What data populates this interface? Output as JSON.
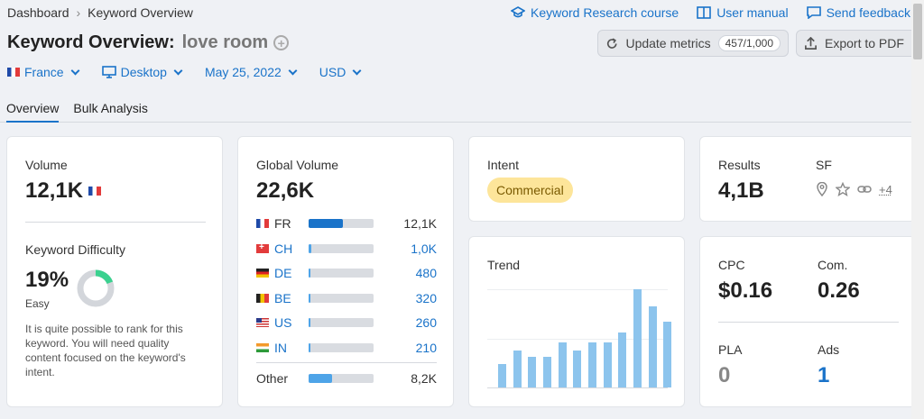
{
  "breadcrumb": {
    "root": "Dashboard",
    "current": "Keyword Overview"
  },
  "toplinks": {
    "course": "Keyword Research course",
    "manual": "User manual",
    "feedback": "Send feedback"
  },
  "title": {
    "label": "Keyword Overview:",
    "keyword": "love room"
  },
  "buttons": {
    "update": "Update metrics",
    "update_count": "457/1,000",
    "export": "Export to PDF"
  },
  "filters": {
    "country": "France",
    "device": "Desktop",
    "date": "May 25, 2022",
    "currency": "USD"
  },
  "tabs": [
    "Overview",
    "Bulk Analysis"
  ],
  "volume": {
    "label": "Volume",
    "value": "12,1K"
  },
  "difficulty": {
    "label": "Keyword Difficulty",
    "value": "19%",
    "level": "Easy",
    "percent": 19,
    "color": "#3bd18f",
    "description": "It is quite possible to rank for this keyword. You will need quality content focused on the keyword's intent."
  },
  "global": {
    "label": "Global Volume",
    "value": "22,6K",
    "rows": [
      {
        "flag": "fr",
        "code": "FR",
        "value": "12,1K",
        "share": 0.53
      },
      {
        "flag": "ch",
        "code": "CH",
        "value": "1,0K",
        "share": 0.04
      },
      {
        "flag": "de",
        "code": "DE",
        "value": "480",
        "share": 0.03
      },
      {
        "flag": "be",
        "code": "BE",
        "value": "320",
        "share": 0.03
      },
      {
        "flag": "us",
        "code": "US",
        "value": "260",
        "share": 0.03
      },
      {
        "flag": "in",
        "code": "IN",
        "value": "210",
        "share": 0.03
      }
    ],
    "other_label": "Other",
    "other_value": "8,2K",
    "other_share": 0.36
  },
  "intent": {
    "label": "Intent",
    "value": "Commercial"
  },
  "trend": {
    "label": "Trend",
    "values": [
      0.24,
      0.38,
      0.31,
      0.31,
      0.46,
      0.38,
      0.46,
      0.46,
      0.56,
      1.0,
      0.83,
      0.67
    ]
  },
  "results": {
    "label": "Results",
    "value": "4,1B"
  },
  "sf": {
    "label": "SF",
    "more": "+4"
  },
  "cpc": {
    "label": "CPC",
    "value": "$0.16"
  },
  "com": {
    "label": "Com.",
    "value": "0.26"
  },
  "pla": {
    "label": "PLA",
    "value": "0"
  },
  "ads": {
    "label": "Ads",
    "value": "1"
  },
  "colors": {
    "accent": "#1a73c9",
    "intent_bg": "#fde59a",
    "trend_bar": "#8cc4ed"
  }
}
